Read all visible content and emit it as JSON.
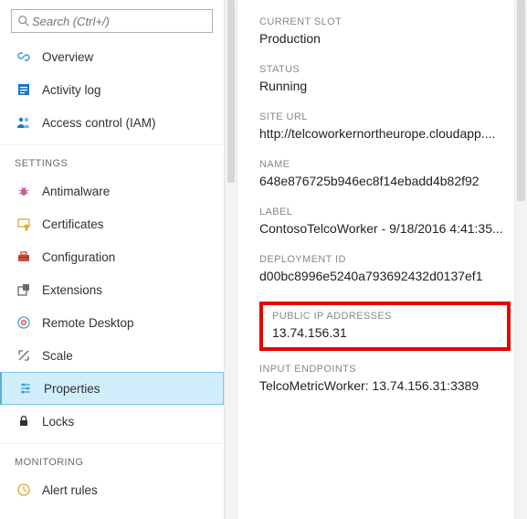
{
  "search": {
    "placeholder": "Search (Ctrl+/)"
  },
  "sections": {
    "settings_label": "SETTINGS",
    "monitoring_label": "MONITORING"
  },
  "nav": {
    "overview": "Overview",
    "activity_log": "Activity log",
    "access_control": "Access control (IAM)",
    "antimalware": "Antimalware",
    "certificates": "Certificates",
    "configuration": "Configuration",
    "extensions": "Extensions",
    "remote_desktop": "Remote Desktop",
    "scale": "Scale",
    "properties": "Properties",
    "locks": "Locks",
    "alert_rules": "Alert rules"
  },
  "details": {
    "current_slot": {
      "label": "CURRENT SLOT",
      "value": "Production"
    },
    "status": {
      "label": "STATUS",
      "value": "Running"
    },
    "site_url": {
      "label": "SITE URL",
      "value": "http://telcoworkernortheurope.cloudapp...."
    },
    "name": {
      "label": "NAME",
      "value": "648e876725b946ec8f14ebadd4b82f92"
    },
    "label_field": {
      "label": "LABEL",
      "value": "ContosoTelcoWorker - 9/18/2016 4:41:35..."
    },
    "deployment_id": {
      "label": "DEPLOYMENT ID",
      "value": "d00bc8996e5240a793692432d0137ef1"
    },
    "public_ip": {
      "label": "PUBLIC IP ADDRESSES",
      "value": "13.74.156.31"
    },
    "input_ep": {
      "label": "INPUT ENDPOINTS",
      "value": "TelcoMetricWorker: 13.74.156.31:3389"
    }
  },
  "colors": {
    "highlight": "#e60000",
    "selected_bg": "#d0eefc"
  }
}
